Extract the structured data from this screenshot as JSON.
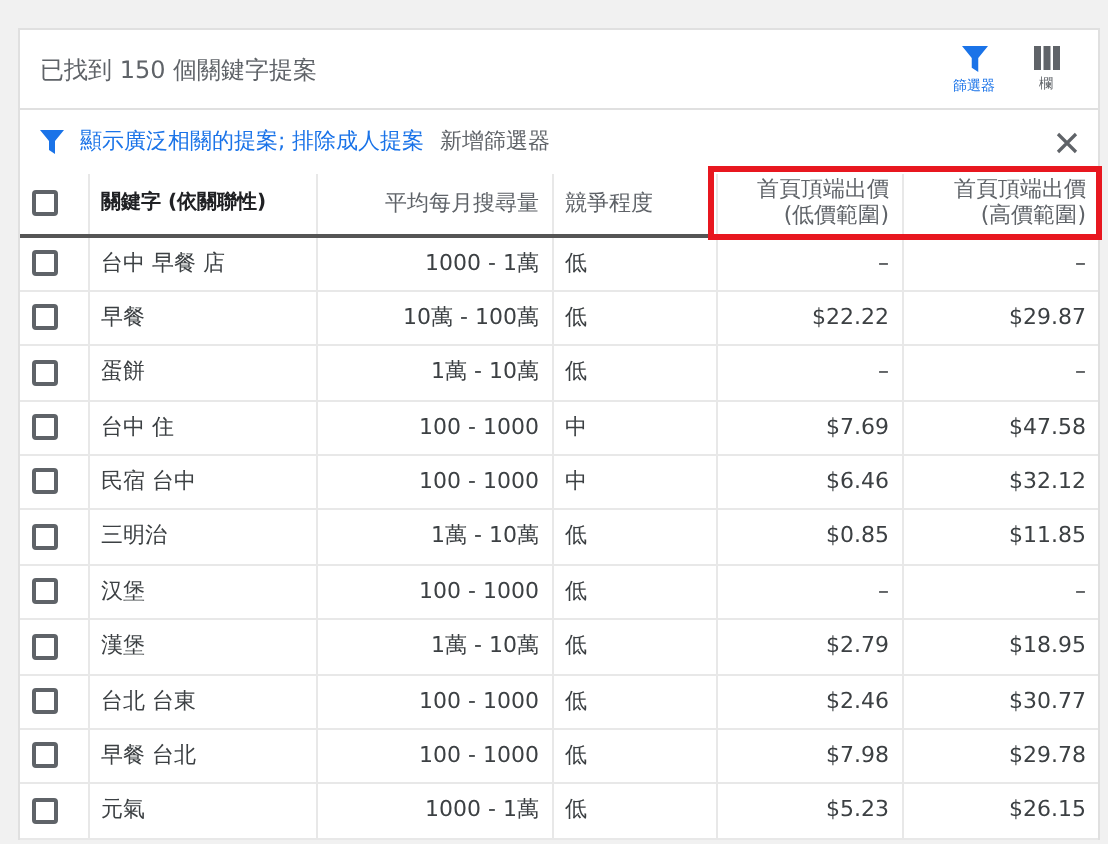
{
  "header": {
    "title": "已找到 150 個關鍵字提案",
    "actions": [
      {
        "kind": "filter",
        "label": "篩選器"
      },
      {
        "kind": "columns",
        "label": "欄"
      }
    ]
  },
  "filter_bar": {
    "text": "顯示廣泛相關的提案; 排除成人提案",
    "add_label": "新增篩選器"
  },
  "table": {
    "select_all_checked": false,
    "columns": [
      {
        "label": "關鍵字 (依關聯性)",
        "highlighted": false
      },
      {
        "label": "平均每月搜尋量",
        "highlighted": false
      },
      {
        "label": "競爭程度",
        "highlighted": false
      },
      {
        "label": "首頁頂端出價\n(低價範圍)",
        "highlighted": true
      },
      {
        "label": "首頁頂端出價\n(高價範圍)",
        "highlighted": true
      }
    ],
    "rows": [
      {
        "checked": false,
        "cells": [
          "台中 早餐 店",
          "1000 - 1萬",
          "低",
          "–",
          "–"
        ]
      },
      {
        "checked": false,
        "cells": [
          "早餐",
          "10萬 - 100萬",
          "低",
          "$22.22",
          "$29.87"
        ]
      },
      {
        "checked": false,
        "cells": [
          "蛋餅",
          "1萬 - 10萬",
          "低",
          "–",
          "–"
        ]
      },
      {
        "checked": false,
        "cells": [
          "台中 住",
          "100 - 1000",
          "中",
          "$7.69",
          "$47.58"
        ]
      },
      {
        "checked": false,
        "cells": [
          "民宿 台中",
          "100 - 1000",
          "中",
          "$6.46",
          "$32.12"
        ]
      },
      {
        "checked": false,
        "cells": [
          "三明治",
          "1萬 - 10萬",
          "低",
          "$0.85",
          "$11.85"
        ]
      },
      {
        "checked": false,
        "cells": [
          "汉堡",
          "100 - 1000",
          "低",
          "–",
          "–"
        ]
      },
      {
        "checked": false,
        "cells": [
          "漢堡",
          "1萬 - 10萬",
          "低",
          "$2.79",
          "$18.95"
        ]
      },
      {
        "checked": false,
        "cells": [
          "台北 台東",
          "100 - 1000",
          "低",
          "$2.46",
          "$30.77"
        ]
      },
      {
        "checked": false,
        "cells": [
          "早餐 台北",
          "100 - 1000",
          "低",
          "$7.98",
          "$29.78"
        ]
      },
      {
        "checked": false,
        "cells": [
          "元氣",
          "1000 - 1萬",
          "低",
          "$5.23",
          "$26.15"
        ]
      }
    ]
  }
}
